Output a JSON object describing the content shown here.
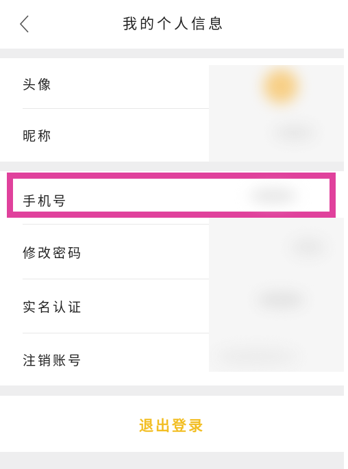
{
  "header": {
    "title": "我的个人信息"
  },
  "profile_rows": [
    {
      "label": "头像"
    },
    {
      "label": "昵称"
    }
  ],
  "account_rows": [
    {
      "label": "手机号"
    },
    {
      "label": "修改密码"
    },
    {
      "label": "实名认证"
    },
    {
      "label": "注销账号"
    }
  ],
  "logout": {
    "label": "退出登录"
  },
  "colors": {
    "accent": "#f2be23",
    "highlight": "#e0419c",
    "section_gap": "#eeeeef"
  }
}
